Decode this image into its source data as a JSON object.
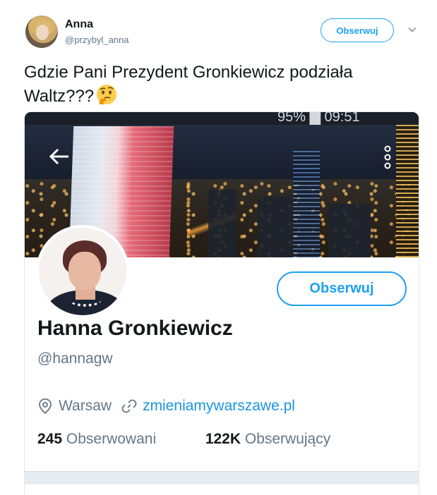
{
  "tweet": {
    "author_name": "Anna",
    "author_handle": "@przybyl_anna",
    "follow_label": "Obserwuj",
    "text": "Gdzie Pani Prezydent Gronkiewicz  podziała Waltz???",
    "emoji": "thinking-face-icon"
  },
  "screenshot": {
    "status_bar": "95% ▇ 09:51",
    "profile": {
      "name": "Hanna Gronkiewicz",
      "handle": "@hannagw",
      "follow_label": "Obserwuj",
      "location": "Warsaw",
      "website": "zmieniamywarszawe.pl",
      "following_count": "245",
      "following_label": "Obserwowani",
      "followers_count": "122K",
      "followers_label": "Obserwujący"
    }
  },
  "colors": {
    "accent": "#1da1f2",
    "link": "#1b95e0",
    "muted": "#657786",
    "text": "#14171a"
  }
}
